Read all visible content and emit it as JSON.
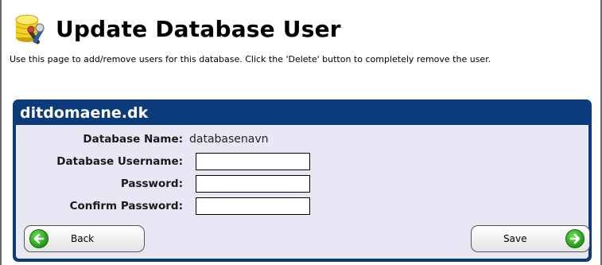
{
  "header": {
    "title": "Update Database User",
    "icon": "database-user-icon"
  },
  "description": "Use this page to add/remove users for this database. Click the 'Delete' button to completely remove the user.",
  "panel": {
    "title": "ditdomaene.dk",
    "header_color": "#0b3b7a",
    "body_color": "#e8e8f5"
  },
  "form": {
    "database_name_label": "Database Name:",
    "database_name_value": "databasenavn",
    "username_label": "Database Username:",
    "username_value": "",
    "password_label": "Password:",
    "password_value": "",
    "confirm_password_label": "Confirm Password:",
    "confirm_password_value": ""
  },
  "buttons": {
    "back_label": "Back",
    "save_label": "Save",
    "icon_color": "#2aa820"
  }
}
